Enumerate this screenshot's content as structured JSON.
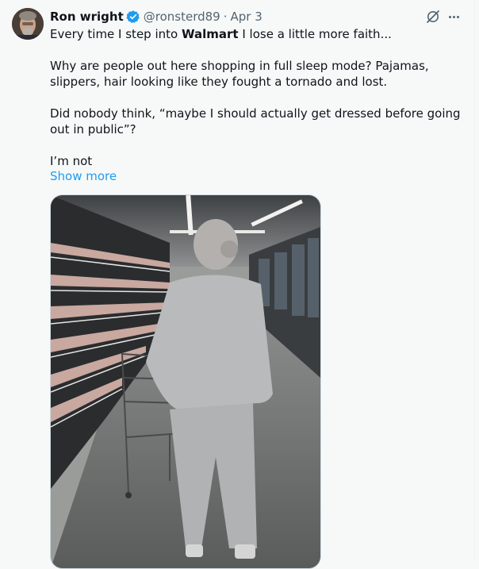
{
  "tweet": {
    "author_name": "Ron wright",
    "handle": "@ronsterd89",
    "separator": "·",
    "date": "Apr 3",
    "text_line1_pre": "Every time I step into ",
    "text_line1_bold": "Walmart",
    "text_line1_post": " I lose a little more faith...",
    "text_para2": "Why are people out here shopping in full sleep mode? Pajamas, slippers, hair looking like they fought a tornado and lost.",
    "text_para3": "Did nobody think, “maybe I should actually get dressed before going out in public”?",
    "text_para4": "I’m not",
    "show_more": "Show more"
  },
  "icons": {
    "verified": "verified-badge-icon",
    "grok": "grok-icon",
    "more": "more-options-icon"
  },
  "colors": {
    "accent": "#1d9bf0",
    "secondary_text": "#536471",
    "primary_text": "#0f1419",
    "background": "#f7f9f9"
  }
}
